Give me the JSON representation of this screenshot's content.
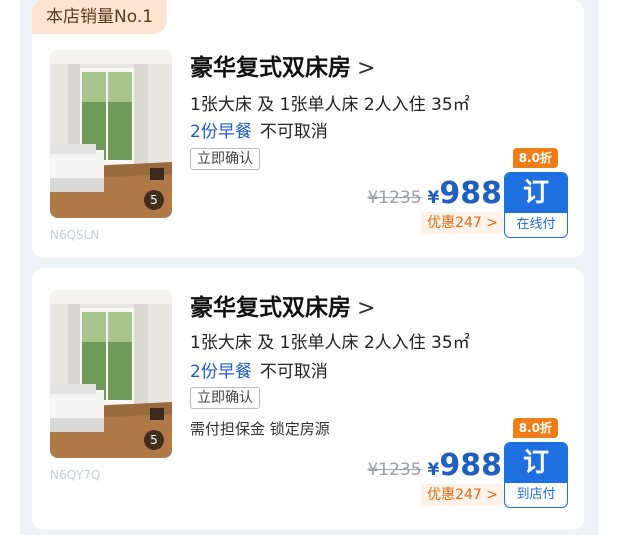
{
  "rooms": [
    {
      "badge": "本店销量No.1",
      "name": "豪华复式双床房",
      "name_chevron": ">",
      "beds": "1张大床 及 1张单人床 2人入住 35㎡",
      "meal": "2份早餐",
      "cancel_policy": "不可取消",
      "confirm_tag": "立即确认",
      "photo_count": "5",
      "code": "N6QSLN",
      "original_price": "¥1235",
      "currency": "¥",
      "price": "988",
      "savings": "优惠247 >",
      "discount": "8.0折",
      "book_label": "订",
      "payment": "在线付"
    },
    {
      "name": "豪华复式双床房",
      "name_chevron": ">",
      "beds": "1张大床 及 1张单人床 2人入住 35㎡",
      "meal": "2份早餐",
      "cancel_policy": "不可取消",
      "confirm_tag": "立即确认",
      "deposit_note": "需付担保金 锁定房源",
      "photo_count": "5",
      "code": "N6QY7Q",
      "original_price": "¥1235",
      "currency": "¥",
      "price": "988",
      "savings": "优惠247 >",
      "discount": "8.0折",
      "book_label": "订",
      "payment": "到店付"
    }
  ],
  "colors": {
    "accent_blue": "#1e6fe0",
    "price_blue": "#1f5fbf",
    "discount_orange": "#f07d17",
    "savings_orange": "#e06a14",
    "badge_bg": "#fde4d2"
  }
}
